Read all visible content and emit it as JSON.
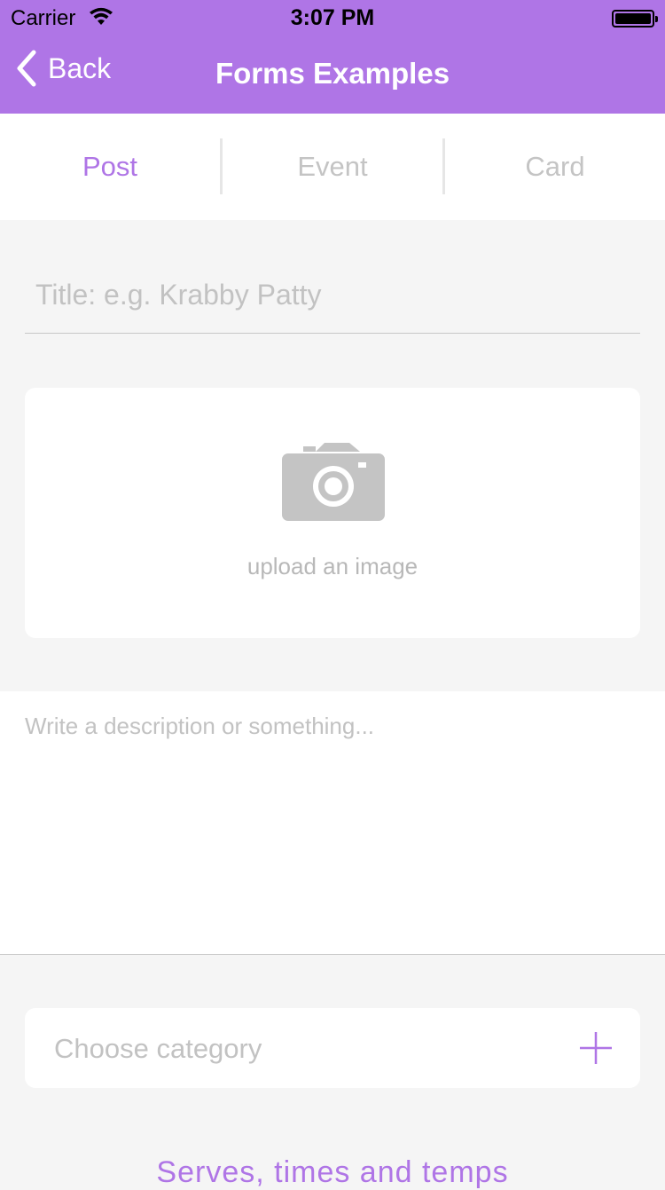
{
  "status_bar": {
    "carrier": "Carrier",
    "time": "3:07 PM"
  },
  "nav": {
    "back_label": "Back",
    "title": "Forms Examples"
  },
  "segments": [
    {
      "label": "Post",
      "active": true
    },
    {
      "label": "Event",
      "active": false
    },
    {
      "label": "Card",
      "active": false
    }
  ],
  "form": {
    "title_placeholder": "Title: e.g. Krabby Patty",
    "upload_label": "upload an image",
    "description_placeholder": "Write a description or something...",
    "category_label": "Choose category",
    "section_title": "Serves, times and temps"
  },
  "colors": {
    "accent": "#af75e6",
    "placeholder": "#c2c2c2",
    "background": "#f5f5f5",
    "icon_gray": "#c4c4c4"
  },
  "icons": {
    "back": "chevron-left-icon",
    "upload": "camera-icon",
    "category_add": "plus-icon"
  }
}
